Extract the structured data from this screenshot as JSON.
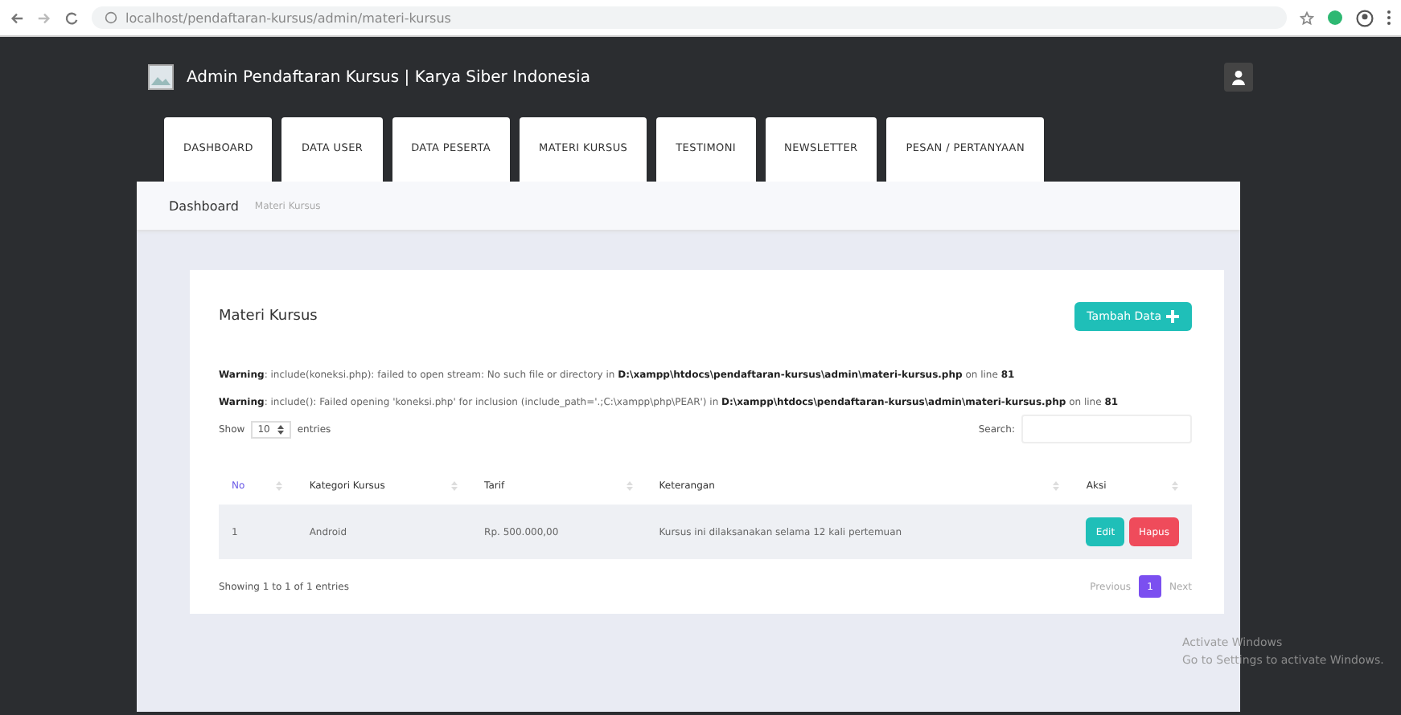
{
  "browser": {
    "url": "localhost/pendaftaran-kursus/admin/materi-kursus"
  },
  "header": {
    "title": "Admin Pendaftaran Kursus | Karya Siber Indonesia"
  },
  "tabs": [
    {
      "label": "DASHBOARD",
      "selected": false
    },
    {
      "label": "DATA USER",
      "selected": false
    },
    {
      "label": "DATA PESERTA",
      "selected": false
    },
    {
      "label": "MATERI KURSUS",
      "selected": false
    },
    {
      "label": "TESTIMONI",
      "selected": false
    },
    {
      "label": "NEWSLETTER",
      "selected": false
    },
    {
      "label": "PESAN / PERTANYAAN",
      "selected": false
    }
  ],
  "breadcrumb": [
    "Dashboard",
    "Materi Kursus"
  ],
  "card": {
    "title": "Materi Kursus",
    "add_button": "Tambah Data",
    "warnings": [
      "**Warning**: include(koneksi.php): failed to open stream: No such file or directory in **D:\\xampp\\htdocs\\pendaftaran-kursus\\admin\\materi-kursus.php** on line **81**",
      "**Warning**: include(): Failed opening 'koneksi.php' for inclusion (include_path='.;C:\\xampp\\php\\PEAR') in **D:\\xampp\\htdocs\\pendaftaran-kursus\\admin\\materi-kursus.php** on line **81**"
    ],
    "length": {
      "before": "Show",
      "value": "10",
      "after": "entries"
    },
    "search_label": "Search:",
    "table": {
      "columns": [
        "No",
        "Kategori Kursus",
        "Tarif",
        "Keterangan",
        "Aksi"
      ],
      "rows": [
        {
          "cells": [
            "1",
            "Android",
            "Rp. 500.000,00",
            "Kursus ini dilaksanakan selama 12 kali pertemuan"
          ],
          "actions": [
            "Edit",
            "Hapus"
          ]
        }
      ]
    },
    "info": "Showing 1 to 1 of 1 entries",
    "pagination": {
      "previous": "Previous",
      "pages": [
        {
          "label": "1",
          "selected": true
        }
      ],
      "next": "Next"
    }
  },
  "os_notice": [
    "Activate Windows",
    "Go to Settings to activate Windows."
  ]
}
